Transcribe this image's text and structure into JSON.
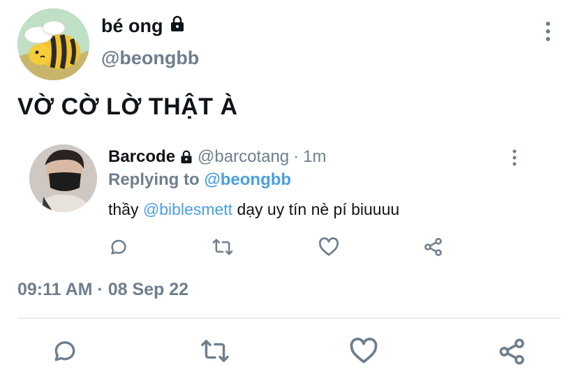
{
  "tweet": {
    "author_name": "bé ong",
    "author_handle": "@beongbb",
    "text": "VỜ CỜ LỜ THẬT À",
    "timestamp_time": "09:11 AM",
    "timestamp_sep": "·",
    "timestamp_date": "08 Sep 22"
  },
  "quoted_reply": {
    "author_name": "Barcode",
    "author_handle": "@barcotang",
    "meta_sep": "·",
    "age": "1m",
    "replying_label": "Replying to",
    "replying_to": "@beongbb",
    "body_prefix": "thầy",
    "body_mention": "@biblesmett",
    "body_suffix": "dạy uy tín nè pí biuuuu"
  },
  "icons": {
    "lock": "lock-icon",
    "more": "more-vertical-icon",
    "reply": "comment-icon",
    "retweet": "retweet-icon",
    "like": "heart-icon",
    "share": "share-icon"
  },
  "colors": {
    "text": "#0f1419",
    "muted": "#6e7f8f",
    "link": "#4a9fe0",
    "divider": "#e6ecf0"
  }
}
